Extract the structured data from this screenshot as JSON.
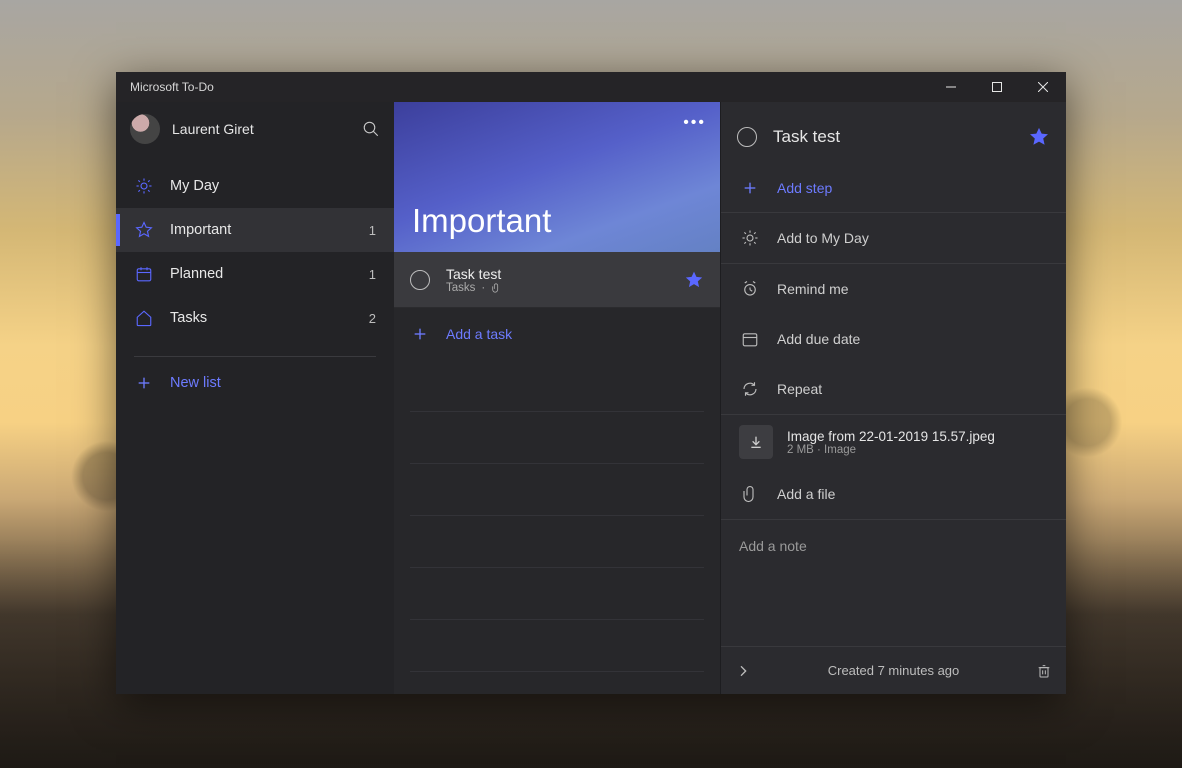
{
  "app_title": "Microsoft To-Do",
  "user": {
    "name": "Laurent Giret"
  },
  "sidebar": {
    "items": [
      {
        "label": "My Day",
        "icon": "sun-icon",
        "count": ""
      },
      {
        "label": "Important",
        "icon": "star-icon",
        "count": "1"
      },
      {
        "label": "Planned",
        "icon": "calendar-icon",
        "count": "1"
      },
      {
        "label": "Tasks",
        "icon": "home-icon",
        "count": "2"
      }
    ],
    "new_list_label": "New list"
  },
  "center": {
    "heading": "Important",
    "task": {
      "title": "Task test",
      "subtitle_list": "Tasks",
      "subtitle_sep": "·"
    },
    "add_task_label": "Add a task"
  },
  "detail": {
    "title": "Task test",
    "add_step_label": "Add step",
    "options": {
      "my_day": "Add to My Day",
      "remind": "Remind me",
      "due": "Add due date",
      "repeat": "Repeat"
    },
    "attachment": {
      "name": "Image from 22-01-2019 15.57.jpeg",
      "meta": "2 MB · Image"
    },
    "add_file_label": "Add a file",
    "note_placeholder": "Add a note",
    "created_label": "Created 7 minutes ago"
  },
  "colors": {
    "accent": "#5a67ff"
  }
}
